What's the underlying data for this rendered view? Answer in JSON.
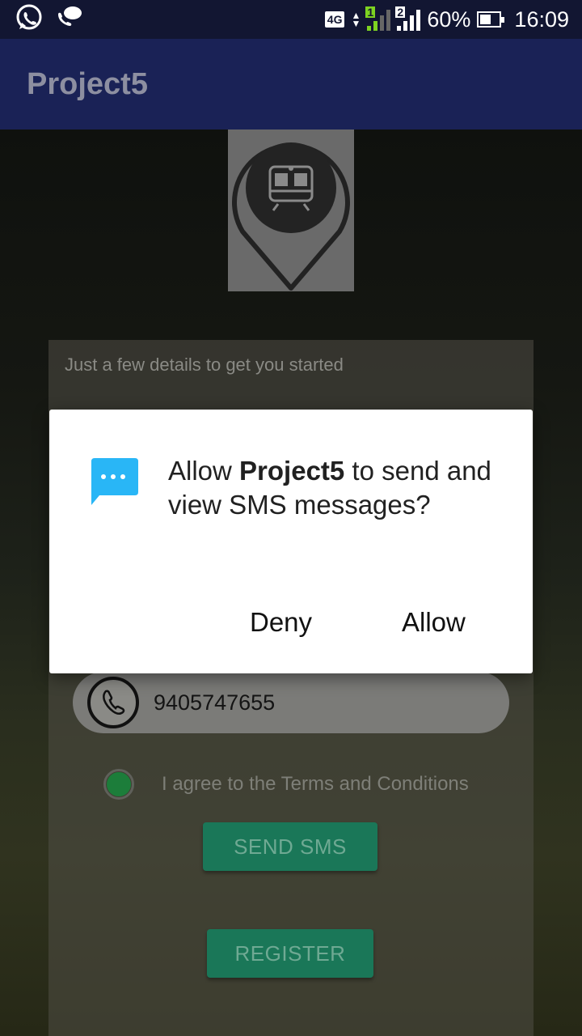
{
  "status_bar": {
    "network": "4G",
    "sim1": "1",
    "sim2": "2",
    "battery": "60%",
    "battery_level": 0.6,
    "time": "16:09"
  },
  "app_bar": {
    "title": "Project5"
  },
  "form": {
    "hint": "Just a few details to get you started",
    "phone_value": "9405747655",
    "agree_label": "I agree to the Terms and Conditions",
    "send_sms_label": "SEND SMS",
    "register_label": "REGISTER"
  },
  "dialog": {
    "prefix": "Allow ",
    "app_name": "Project5",
    "suffix": " to send and view SMS messages?",
    "deny_label": "Deny",
    "allow_label": "Allow"
  },
  "colors": {
    "status_bar": "#121632",
    "app_bar": "#1a2256",
    "accent_green": "#1a7758",
    "sms_icon": "#29b6f6"
  }
}
